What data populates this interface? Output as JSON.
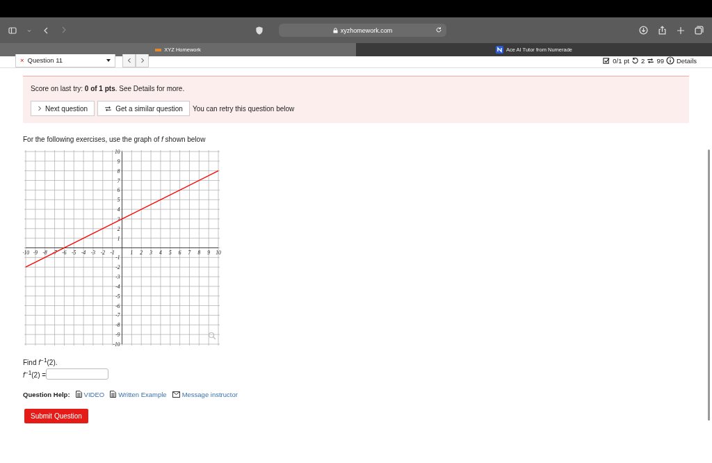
{
  "browser": {
    "url": "xyzhomework.com",
    "tabs": [
      {
        "label": "XYZ Homework",
        "selected": true
      },
      {
        "label": "Ace AI Tutor from Numerade",
        "selected": false
      }
    ]
  },
  "question_bar": {
    "status_mark": "×",
    "question": "Question 11",
    "score": "0/1 pt",
    "retries": "2",
    "attempts": "99",
    "details": "Details"
  },
  "alert": {
    "message": "Score on last try: **0 of 1 pts**. See Details for more.",
    "buttons": [
      "Next question",
      "Get a similar question"
    ],
    "note": "You can retry this question below"
  },
  "intro": "For the following exercises, use the graph of *f* shown below",
  "chart_data": {
    "type": "line",
    "x": [
      -10,
      10
    ],
    "grid": true,
    "series": [
      {
        "color": "#ff0000",
        "values": [
          -2,
          8
        ]
      }
    ],
    "xlim": [
      -10,
      10
    ],
    "ylim": [
      -10,
      10
    ],
    "xticks": [
      -10,
      -9,
      -8,
      -7,
      -6,
      -5,
      -4,
      -3,
      -2,
      -1,
      1,
      2,
      3,
      4,
      5,
      6,
      7,
      8,
      9,
      10
    ],
    "yticks": [
      -10,
      -9,
      -8,
      -7,
      -6,
      -5,
      -4,
      -3,
      -2,
      -1,
      1,
      2,
      3,
      4,
      5,
      6,
      7,
      8,
      9,
      10
    ]
  },
  "question": "Find *f*$^{−1}$(2).",
  "answer_label": "*f*$^{−1}$(2) =",
  "help": {
    "label": "Question Help:",
    "links": [
      "VIDEO",
      "Written Example",
      "Message instructor"
    ]
  },
  "submit": "Submit Question"
}
